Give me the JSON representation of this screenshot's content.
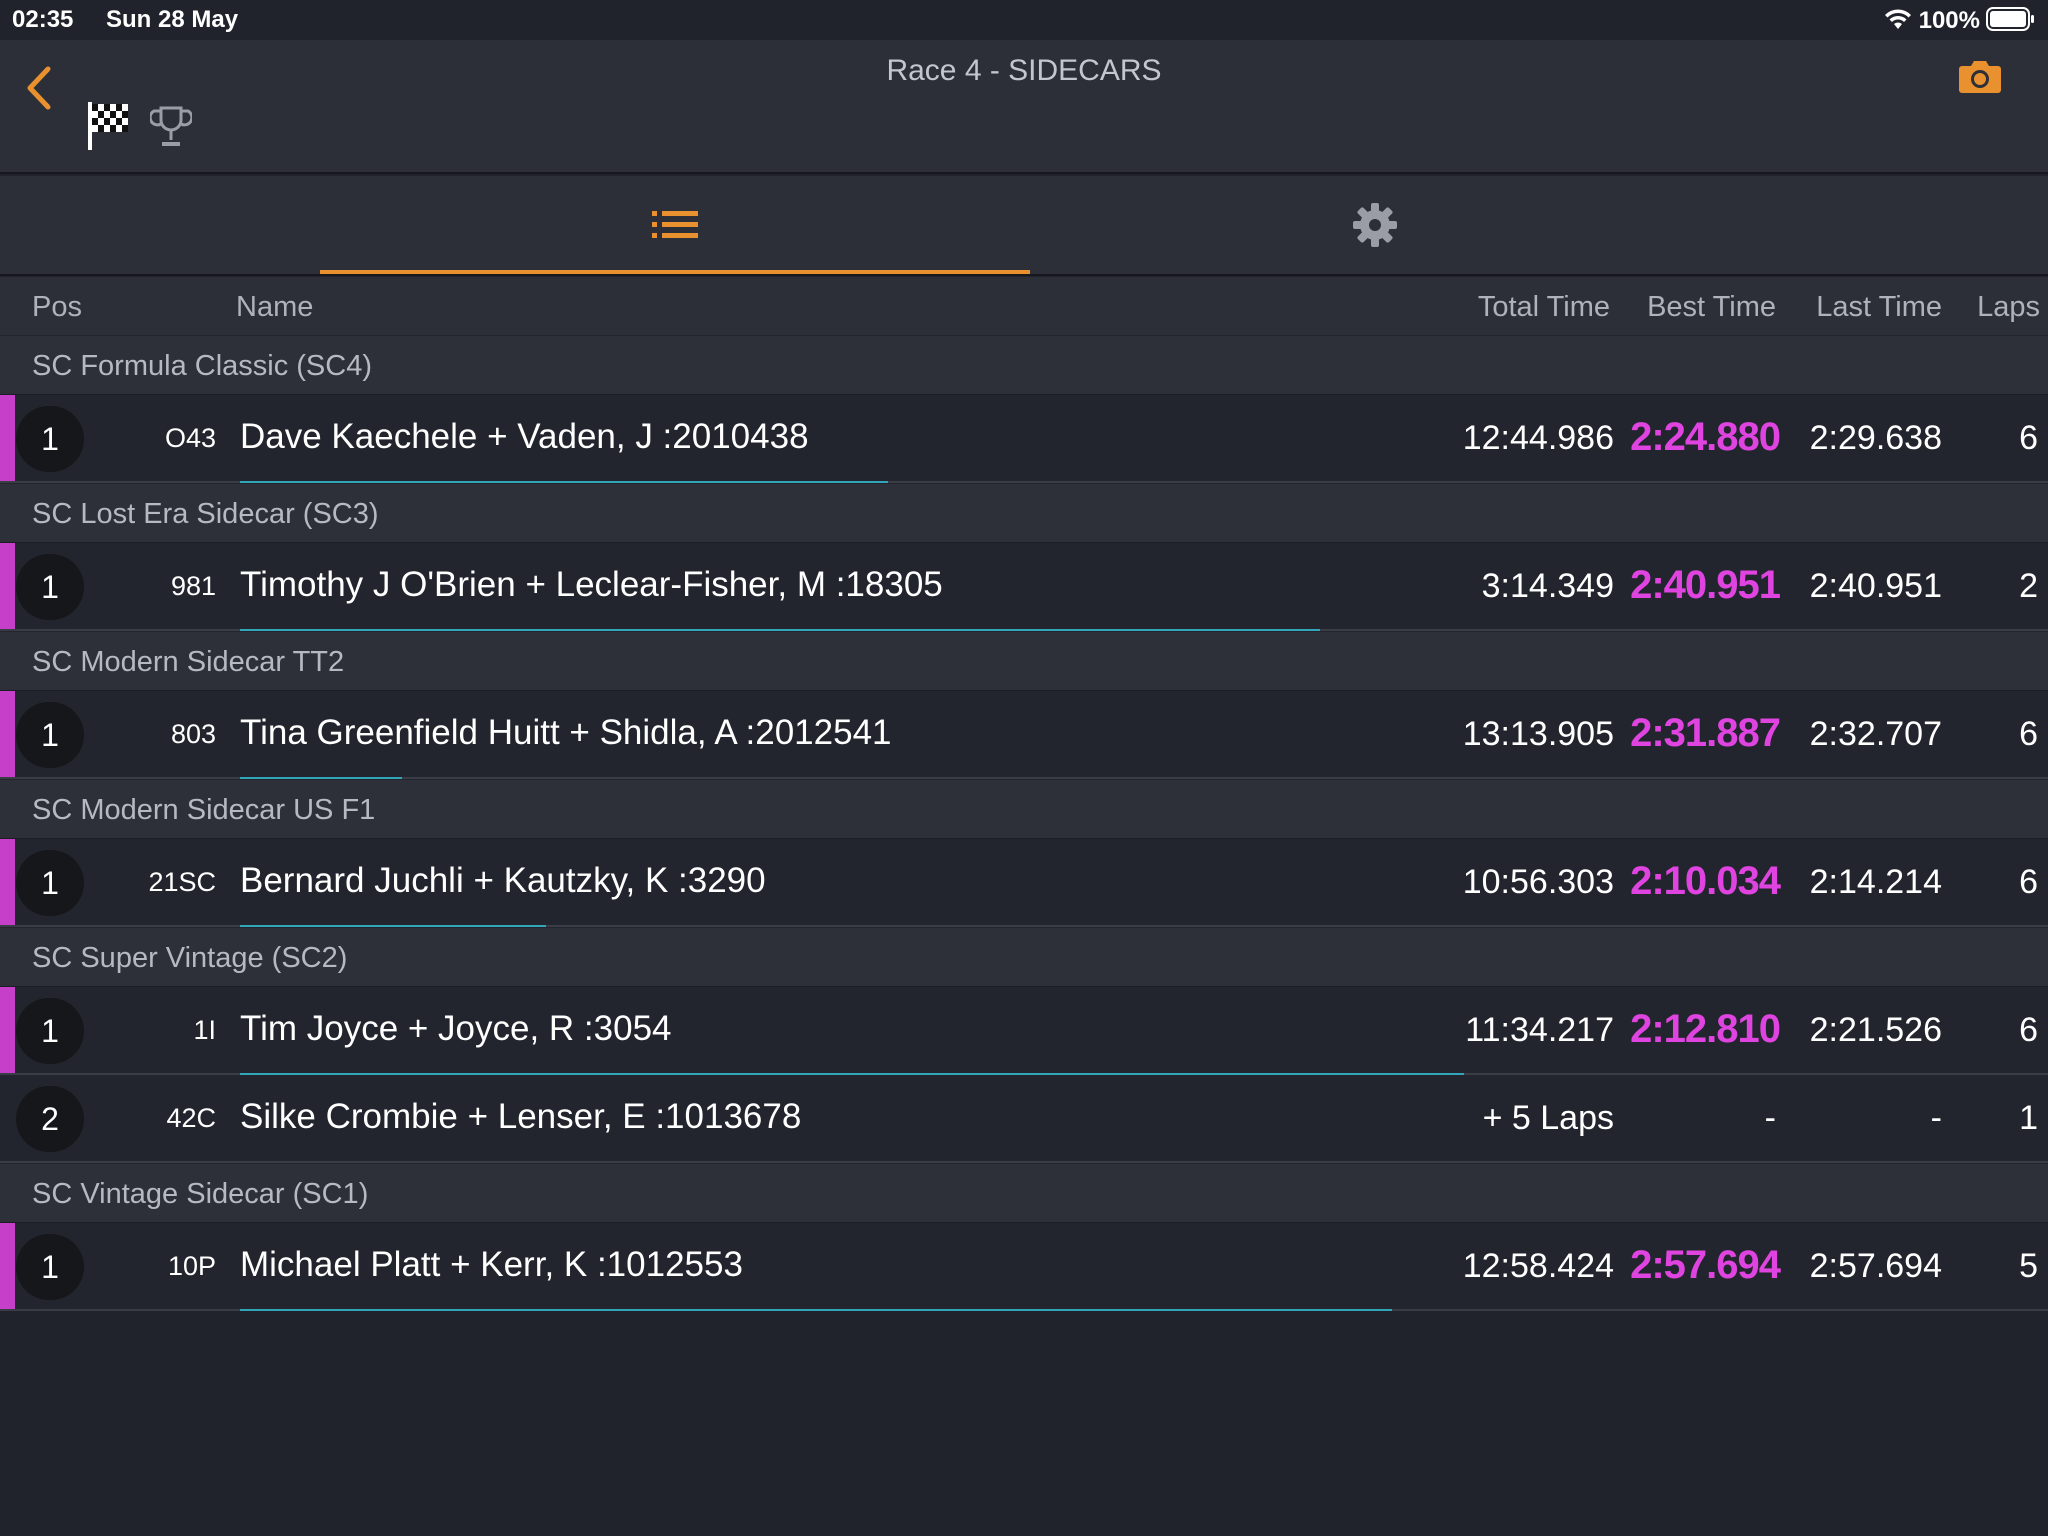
{
  "status_bar": {
    "time": "02:35",
    "date": "Sun 28 May",
    "battery": "100%"
  },
  "nav": {
    "title": "Race 4 - SIDECARS"
  },
  "columns": {
    "pos": "Pos",
    "name": "Name",
    "total": "Total Time",
    "best": "Best Time",
    "last": "Last Time",
    "laps": "Laps"
  },
  "colors": {
    "accent": "#e8912e",
    "best_time": "#e044e0",
    "class_strip": "#c63fc8",
    "progress": "#32a6b9"
  },
  "groups": [
    {
      "title": "SC Formula Classic (SC4)",
      "rows": [
        {
          "pos": "1",
          "num": "O43",
          "name": "Dave Kaechele + Vaden, J :2010438",
          "total": "12:44.986",
          "best": "2:24.880",
          "last": "2:29.638",
          "laps": "6",
          "progress": 0.36
        }
      ]
    },
    {
      "title": "SC Lost Era Sidecar (SC3)",
      "rows": [
        {
          "pos": "1",
          "num": "981",
          "name": "Timothy J O'Brien + Leclear-Fisher, M :18305",
          "total": "3:14.349",
          "best": "2:40.951",
          "last": "2:40.951",
          "laps": "2",
          "progress": 0.6
        }
      ]
    },
    {
      "title": "SC Modern Sidecar TT2",
      "rows": [
        {
          "pos": "1",
          "num": "803",
          "name": "Tina Greenfield Huitt + Shidla, A :2012541",
          "total": "13:13.905",
          "best": "2:31.887",
          "last": "2:32.707",
          "laps": "6",
          "progress": 0.09
        }
      ]
    },
    {
      "title": "SC Modern Sidecar US F1",
      "rows": [
        {
          "pos": "1",
          "num": "21SC",
          "name": "Bernard Juchli + Kautzky, K :3290",
          "total": "10:56.303",
          "best": "2:10.034",
          "last": "2:14.214",
          "laps": "6",
          "progress": 0.17
        }
      ]
    },
    {
      "title": "SC Super Vintage (SC2)",
      "rows": [
        {
          "pos": "1",
          "num": "1I",
          "name": "Tim Joyce + Joyce, R :3054",
          "total": "11:34.217",
          "best": "2:12.810",
          "last": "2:21.526",
          "laps": "6",
          "progress": 0.68
        },
        {
          "pos": "2",
          "num": "42C",
          "name": "Silke Crombie + Lenser, E :1013678",
          "total": "+ 5 Laps",
          "best": "-",
          "last": "-",
          "laps": "1",
          "progress": 0
        }
      ]
    },
    {
      "title": "SC Vintage Sidecar (SC1)",
      "rows": [
        {
          "pos": "1",
          "num": "10P",
          "name": "Michael Platt + Kerr, K :1012553",
          "total": "12:58.424",
          "best": "2:57.694",
          "last": "2:57.694",
          "laps": "5",
          "progress": 0.64
        }
      ]
    }
  ]
}
